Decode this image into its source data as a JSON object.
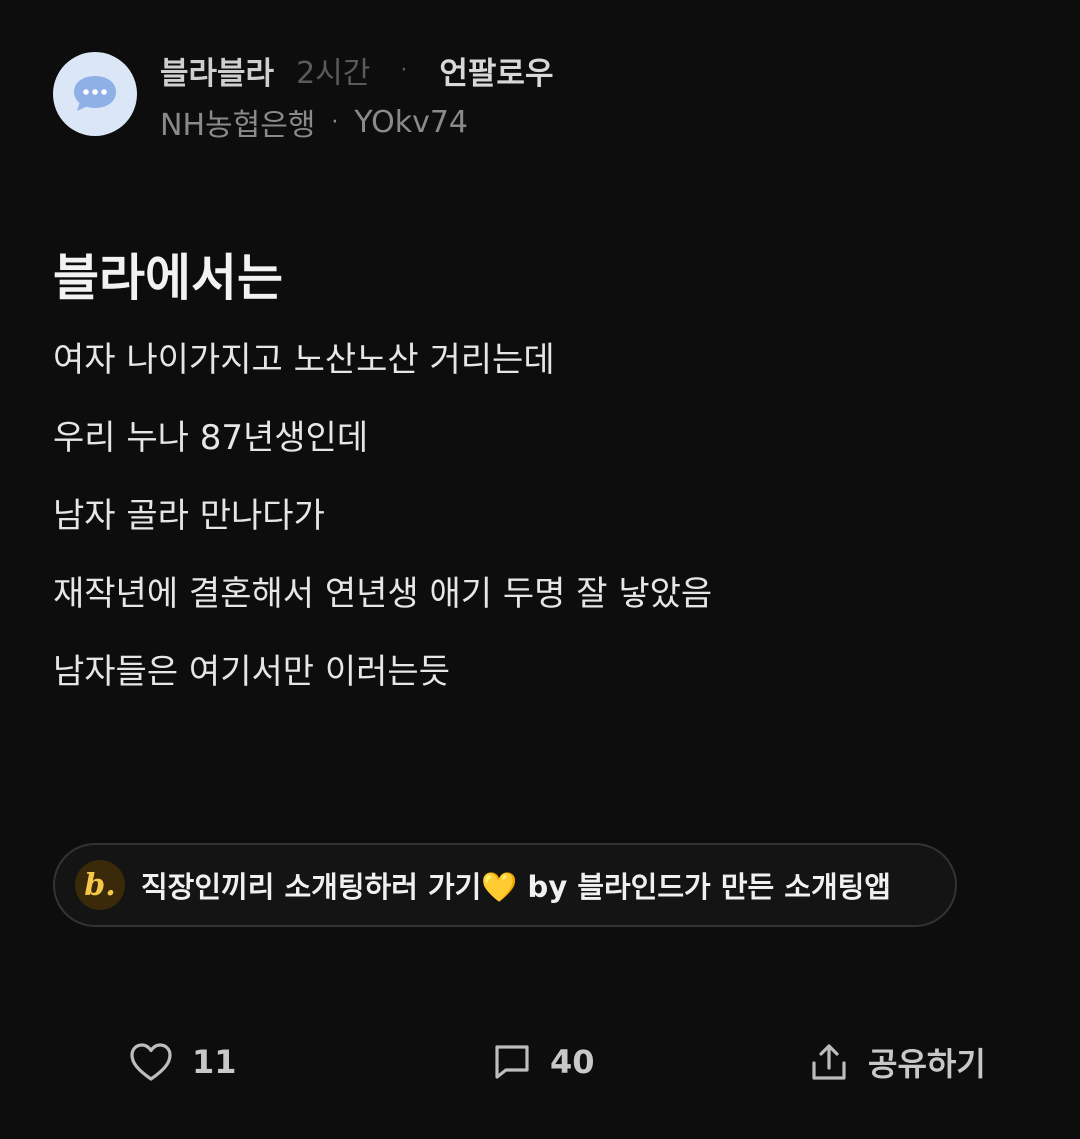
{
  "post": {
    "board": "블라블라",
    "time": "2시간",
    "separator": "·",
    "unfollow_label": "언팔로우",
    "company": "NH농협은행",
    "author_id": "YOkv74",
    "title": "블라에서는",
    "body_lines": [
      "여자 나이가지고 노산노산 거리는데",
      "우리 누나 87년생인데",
      "남자 골라 만나다가",
      "재작년에 결혼해서 연년생 애기 두명 잘 낳았음",
      "남자들은 여기서만 이러는듯"
    ]
  },
  "promo": {
    "logo_letter": "b.",
    "text": "직장인끼리 소개팅하러 가기💛 by 블라인드가 만든 소개팅앱"
  },
  "actions": {
    "like_count": "11",
    "comment_count": "40",
    "share_label": "공유하기"
  },
  "icons": {
    "avatar": "chat-bubble-icon",
    "like": "heart-icon",
    "comment": "comment-icon",
    "share": "share-icon"
  },
  "colors": {
    "background": "#0d0d0d",
    "avatar_bg": "#dbe6f7",
    "avatar_icon": "#8fb0e6",
    "promo_logo": "#f5c84a"
  }
}
